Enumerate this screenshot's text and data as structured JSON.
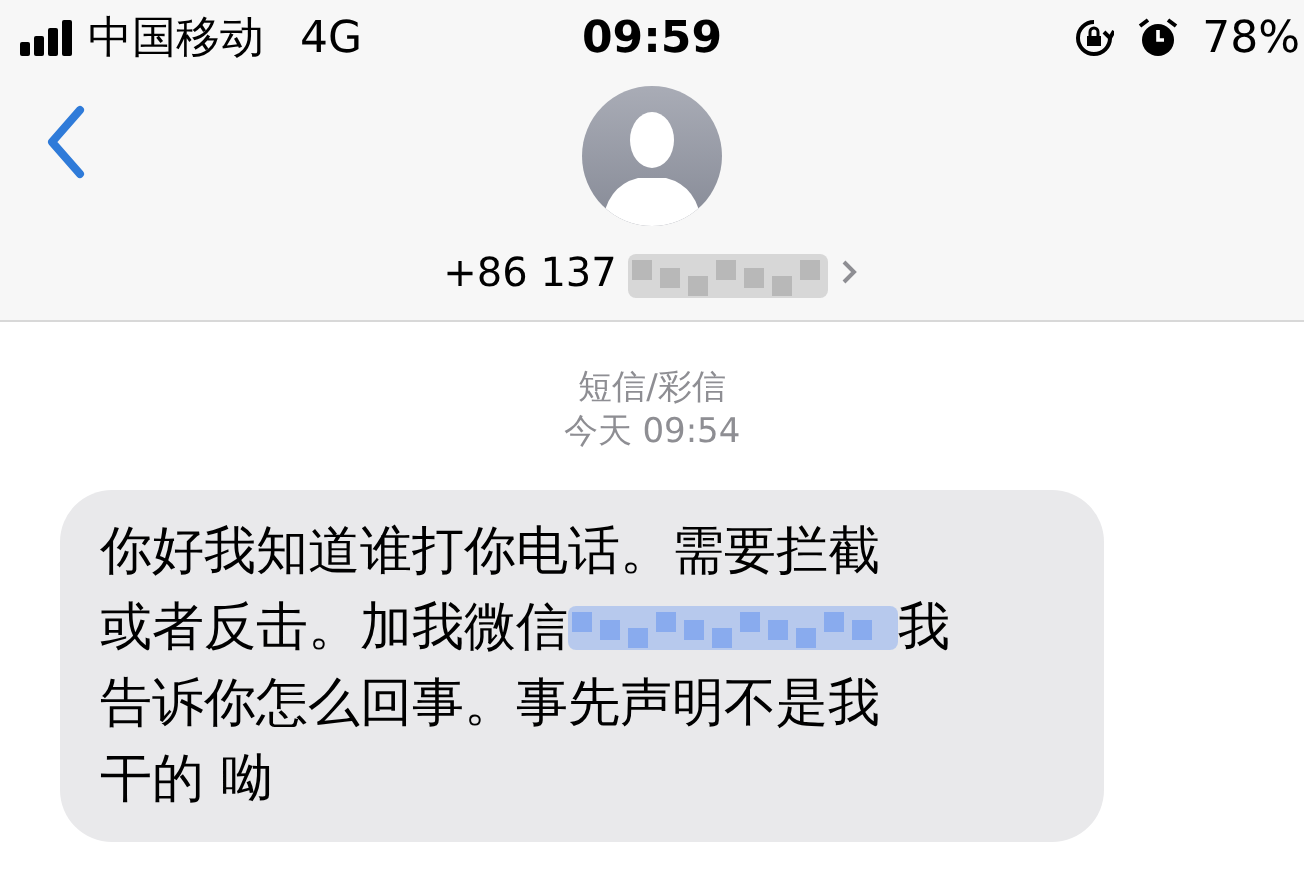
{
  "status_bar": {
    "carrier": "中国移动",
    "network": "4G",
    "time": "09:59",
    "battery": "78%"
  },
  "contact": {
    "number": "+86 137"
  },
  "thread": {
    "service": "短信/彩信",
    "timestamp": "今天 09:54"
  },
  "messages": [
    {
      "kind": "incoming",
      "lines": [
        [
          {
            "kind": "text",
            "text": "你好我知道谁打你电话。需要拦截"
          }
        ],
        [
          {
            "kind": "text",
            "text": "或者反击。加我微信"
          },
          {
            "kind": "redaction"
          },
          {
            "kind": "text",
            "text": "我"
          }
        ],
        [
          {
            "kind": "text",
            "text": "告诉你怎么回事。事先声明不是我"
          }
        ],
        [
          {
            "kind": "text",
            "text": "干的 呦"
          }
        ]
      ]
    }
  ]
}
